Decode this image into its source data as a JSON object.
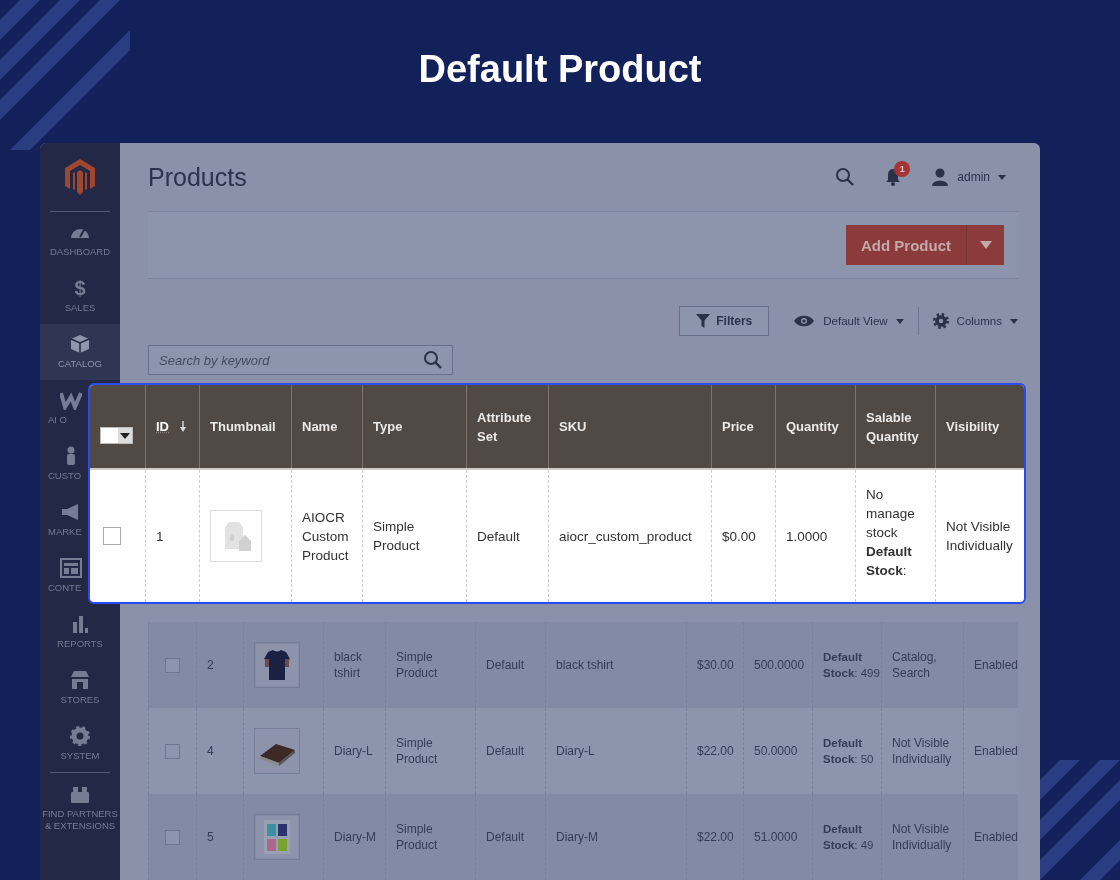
{
  "banner": {
    "title": "Default Product"
  },
  "sidebar": {
    "items": [
      {
        "label": "DASHBOARD",
        "selected": false
      },
      {
        "label": "SALES",
        "selected": false,
        "glyph": "$"
      },
      {
        "label": "CATALOG",
        "selected": true
      },
      {
        "label": "AI O",
        "selected": false
      },
      {
        "label": "CUSTO",
        "selected": false
      },
      {
        "label": "MARKE",
        "selected": false
      },
      {
        "label": "CONTE",
        "selected": false
      },
      {
        "label": "REPORTS",
        "selected": false
      },
      {
        "label": "STORES",
        "selected": false
      },
      {
        "label": "SYSTEM",
        "selected": false
      },
      {
        "label": "FIND PARTNERS & EXTENSIONS",
        "selected": false
      }
    ]
  },
  "header": {
    "title": "Products",
    "notifications": "1",
    "user": "admin"
  },
  "actions": {
    "primary": "Add Product"
  },
  "toolbar": {
    "filters": "Filters",
    "view": "Default View",
    "columns": "Columns"
  },
  "search": {
    "placeholder": "Search by keyword"
  },
  "highlight": {
    "select_all": {
      "checked": false
    },
    "columns": [
      {
        "label": "ID",
        "sorted": true
      },
      {
        "label": "Thumbnail",
        "sorted": false
      },
      {
        "label": "Name",
        "sorted": false
      },
      {
        "label": "Type",
        "sorted": false
      },
      {
        "label": "Attribute Set",
        "sorted": false
      },
      {
        "label": "SKU",
        "sorted": false
      },
      {
        "label": "Price",
        "sorted": false
      },
      {
        "label": "Quantity",
        "sorted": false
      },
      {
        "label": "Salable Quantity",
        "sorted": false
      },
      {
        "label": "Visibility",
        "sorted": false
      }
    ],
    "row": {
      "selected": false,
      "cells": [
        "1",
        "AIOCR Custom Product",
        "Simple Product",
        "Default",
        "aiocr_custom_product",
        "$0.00",
        "1.0000",
        "No manage stock **Default Stock**:",
        "Not Visible Individually"
      ]
    }
  },
  "grid": {
    "rows": [
      {
        "selected": false,
        "cells": [
          "2",
          "black tshirt",
          "Simple Product",
          "Default",
          "black tshirt",
          "$30.00",
          "500.0000",
          "**Default Stock**: 499",
          "Catalog, Search",
          "Enabled"
        ]
      },
      {
        "selected": false,
        "cells": [
          "4",
          "Diary-L",
          "Simple Product",
          "Default",
          "Diary-L",
          "$22.00",
          "50.0000",
          "**Default Stock**: 50",
          "Not Visible Individually",
          "Enabled"
        ]
      },
      {
        "selected": false,
        "cells": [
          "5",
          "Diary-M",
          "Simple Product",
          "Default",
          "Diary-M",
          "$22.00",
          "51.0000",
          "**Default Stock**: 49",
          "Not Visible Individually",
          "Enabled"
        ]
      }
    ]
  }
}
